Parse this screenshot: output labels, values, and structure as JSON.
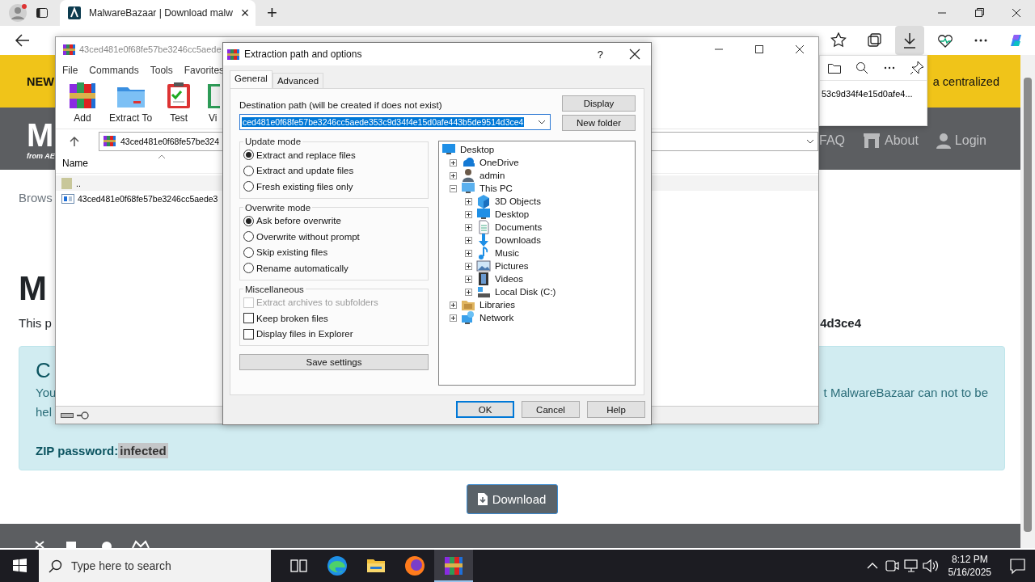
{
  "browser": {
    "tab": {
      "title": "MalwareBazaar | Download malw",
      "close": "×"
    },
    "new_tab": "+",
    "toolbar": [
      {
        "kind": "favorites",
        "active": false
      },
      {
        "kind": "collections",
        "active": false
      },
      {
        "kind": "downloads",
        "active": true
      },
      {
        "kind": "health",
        "active": false
      },
      {
        "kind": "more",
        "active": false
      },
      {
        "kind": "copilot",
        "active": false
      }
    ]
  },
  "page": {
    "banner": {
      "left": "NEW",
      "right": "a centralized"
    },
    "header": {
      "logo": "M",
      "logo_sub": "from AE",
      "nav": [
        {
          "label": "FAQ",
          "kind": "text"
        },
        {
          "label": "About",
          "kind": "building"
        },
        {
          "label": "Login",
          "kind": "user"
        }
      ]
    },
    "breadcrumb": "Brows",
    "heading": "M",
    "intro": {
      "left": "This p",
      "right": "4d3ce4"
    },
    "notice": {
      "heading": "C",
      "lines": [
        "You",
        "hel"
      ],
      "right": "t MalwareBazaar can not to be",
      "password_label": "ZIP password:",
      "password": "infected"
    },
    "download_button": "Download"
  },
  "downloads_panel": {
    "file": "53c9d34f4e15d0afe4..."
  },
  "winrar": {
    "title": "43ced481e0f68fe57be3246cc5aede",
    "menu": [
      "File",
      "Commands",
      "Tools",
      "Favorites"
    ],
    "toolbar": [
      {
        "label": "Add",
        "kind": "add"
      },
      {
        "label": "Extract To",
        "kind": "extract"
      },
      {
        "label": "Test",
        "kind": "test"
      },
      {
        "label": "Vi",
        "kind": "view"
      }
    ],
    "address": "43ced481e0f68fe57be324",
    "columns": [
      "Name"
    ],
    "files": [
      {
        "name": "..",
        "kind": "up"
      },
      {
        "name": "43ced481e0f68fe57be3246cc5aede3",
        "kind": "file"
      }
    ]
  },
  "dialog": {
    "title": "Extraction path and options",
    "help": "?",
    "tabs": [
      {
        "label": "General",
        "selected": true
      },
      {
        "label": "Advanced",
        "selected": false
      }
    ],
    "destination_label": "Destination path (will be created if does not exist)",
    "destination": "ced481e0f68fe57be3246cc5aede353c9d34f4e15d0afe443b5de9514d3ce4",
    "side_buttons": [
      "Display",
      "New folder"
    ],
    "groups": [
      {
        "title": "Update mode",
        "options": [
          {
            "label": "Extract and replace files",
            "kind": "radio",
            "checked": true,
            "disabled": false
          },
          {
            "label": "Extract and update files",
            "kind": "radio",
            "checked": false,
            "disabled": false
          },
          {
            "label": "Fresh existing files only",
            "kind": "radio",
            "checked": false,
            "disabled": false
          }
        ]
      },
      {
        "title": "Overwrite mode",
        "options": [
          {
            "label": "Ask before overwrite",
            "kind": "radio",
            "checked": true,
            "disabled": false
          },
          {
            "label": "Overwrite without prompt",
            "kind": "radio",
            "checked": false,
            "disabled": false
          },
          {
            "label": "Skip existing files",
            "kind": "radio",
            "checked": false,
            "disabled": false
          },
          {
            "label": "Rename automatically",
            "kind": "radio",
            "checked": false,
            "disabled": false
          }
        ]
      },
      {
        "title": "Miscellaneous",
        "options": [
          {
            "label": "Extract archives to subfolders",
            "kind": "checkbox",
            "checked": false,
            "disabled": true
          },
          {
            "label": "Keep broken files",
            "kind": "checkbox",
            "checked": false,
            "disabled": false
          },
          {
            "label": "Display files in Explorer",
            "kind": "checkbox",
            "checked": false,
            "disabled": false
          }
        ]
      }
    ],
    "save_button": "Save settings",
    "tree": [
      {
        "label": "Desktop",
        "kind": "desktop",
        "children": [
          {
            "label": "OneDrive",
            "kind": "cloud",
            "expanded": false
          },
          {
            "label": "admin",
            "kind": "user",
            "expanded": false
          },
          {
            "label": "This PC",
            "kind": "pc",
            "expanded": true,
            "children": [
              {
                "label": "3D Objects",
                "kind": "cube",
                "expanded": false
              },
              {
                "label": "Desktop",
                "kind": "desktop",
                "expanded": false
              },
              {
                "label": "Documents",
                "kind": "documents",
                "expanded": false
              },
              {
                "label": "Downloads",
                "kind": "downloads",
                "expanded": false
              },
              {
                "label": "Music",
                "kind": "music",
                "expanded": false
              },
              {
                "label": "Pictures",
                "kind": "pictures",
                "expanded": false
              },
              {
                "label": "Videos",
                "kind": "videos",
                "expanded": false
              },
              {
                "label": "Local Disk (C:)",
                "kind": "disk",
                "expanded": false
              }
            ]
          },
          {
            "label": "Libraries",
            "kind": "libraries",
            "expanded": false
          },
          {
            "label": "Network",
            "kind": "network",
            "expanded": false
          }
        ]
      }
    ],
    "buttons": [
      {
        "label": "OK",
        "default": true
      },
      {
        "label": "Cancel",
        "default": false
      },
      {
        "label": "Help",
        "default": false
      }
    ]
  },
  "taskbar": {
    "search_placeholder": "Type here to search",
    "apps": [
      {
        "kind": "taskview",
        "selected": false
      },
      {
        "kind": "edge",
        "selected": false
      },
      {
        "kind": "explorer",
        "selected": false
      },
      {
        "kind": "firefox",
        "selected": false
      },
      {
        "kind": "winrar",
        "selected": true
      }
    ],
    "time": "8:12 PM",
    "date": "5/16/2025"
  }
}
